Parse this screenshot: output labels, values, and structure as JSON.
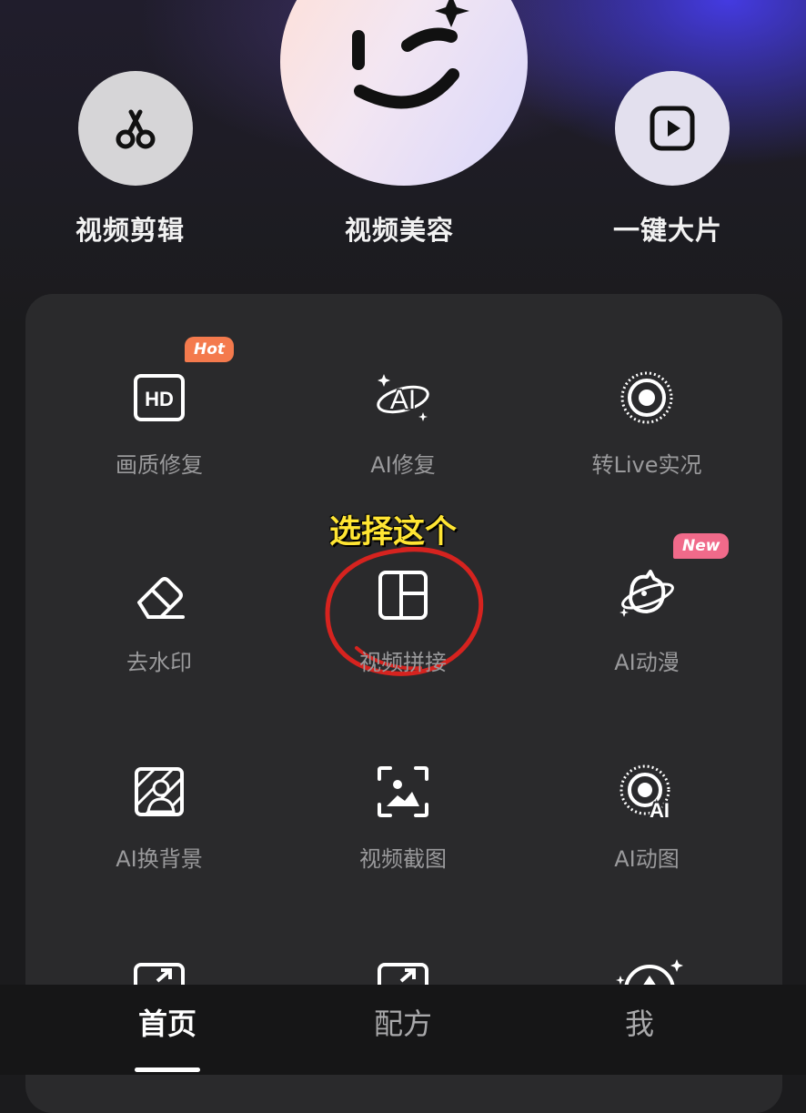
{
  "features": [
    {
      "label": "视频剪辑",
      "icon": "scissors-icon"
    },
    {
      "label": "视频美容",
      "icon": "smile-face-icon"
    },
    {
      "label": "一键大片",
      "icon": "play-box-icon"
    }
  ],
  "tools": [
    {
      "label": "画质修复",
      "icon": "hd-icon",
      "badge": "Hot"
    },
    {
      "label": "AI修复",
      "icon": "ai-sparkle-icon"
    },
    {
      "label": "转Live实况",
      "icon": "live-photo-icon"
    },
    {
      "label": "去水印",
      "icon": "eraser-icon"
    },
    {
      "label": "视频拼接",
      "icon": "layout-grid-icon"
    },
    {
      "label": "AI动漫",
      "icon": "planet-icon",
      "badge": "New"
    },
    {
      "label": "AI换背景",
      "icon": "replace-background-icon"
    },
    {
      "label": "视频截图",
      "icon": "screenshot-icon"
    },
    {
      "label": "AI动图",
      "icon": "ai-live-icon"
    }
  ],
  "annotation": "选择这个",
  "colors": {
    "hot_badge": "#f47a4d",
    "new_badge": "#f06a8a",
    "annotation_text": "#ffe533",
    "annotation_circle": "#d6231f"
  },
  "tabbar": {
    "tabs": [
      {
        "label": "首页",
        "active": true
      },
      {
        "label": "配方",
        "active": false
      },
      {
        "label": "我",
        "active": false
      }
    ]
  }
}
